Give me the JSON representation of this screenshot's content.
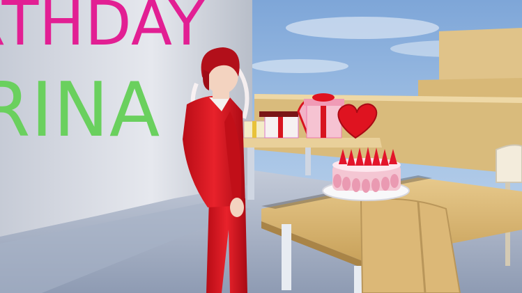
{
  "scene": {
    "banner": {
      "line1": "RTHDAY",
      "line2": "RINA"
    }
  },
  "colors": {
    "sky": "#9fbde0",
    "banner_wall": "#d9dde6",
    "banner_line1": "#e21f93",
    "banner_line2": "#6ad05e",
    "suit": "#d8121c",
    "hair": "#b20f1a",
    "table_top": "#d7b36a",
    "chair": "#d9b574",
    "cake": "#f4c8d4",
    "strawberry": "#e3142a",
    "heart": "#e0121f",
    "floor": "#b5bfd0"
  },
  "icons": [
    "gift-box-icon",
    "heart-icon",
    "cake-icon"
  ]
}
